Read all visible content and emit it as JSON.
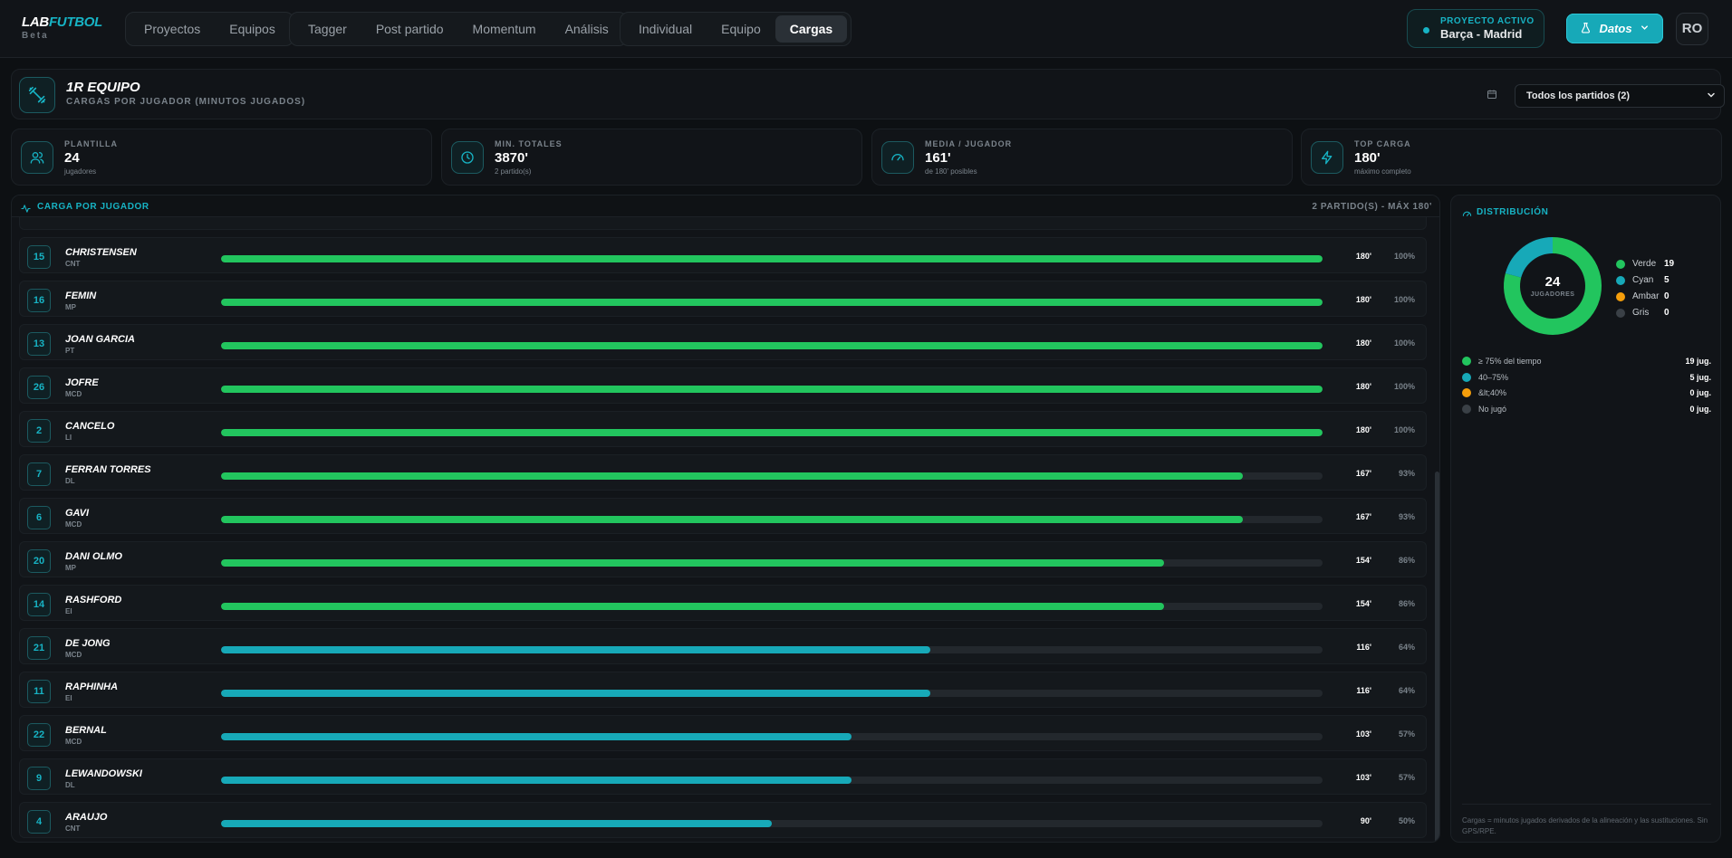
{
  "app": {
    "logo_a": "LAB",
    "logo_b": "FUTBOL",
    "logo_sub": "Beta"
  },
  "nav": {
    "group1": [
      "Proyectos",
      "Equipos"
    ],
    "group2": [
      "Tagger",
      "Post partido",
      "Momentum",
      "Análisis"
    ],
    "group3": [
      "Individual",
      "Equipo",
      "Cargas"
    ],
    "active": "Cargas"
  },
  "project": {
    "label": "PROYECTO ACTIVO",
    "name": "Barça - Madrid"
  },
  "datos_button": "Datos",
  "user_initials": "RO",
  "header": {
    "title": "1R EQUIPO",
    "subtitle": "CARGAS POR JUGADOR (MINUTOS JUGADOS)",
    "filter_value": "Todos los partidos (2)"
  },
  "stats": [
    {
      "label": "PLANTILLA",
      "value": "24",
      "sub": "jugadores",
      "icon": "users-icon"
    },
    {
      "label": "MIN. TOTALES",
      "value": "3870'",
      "sub": "2 partido(s)",
      "icon": "clock-icon"
    },
    {
      "label": "MEDIA / JUGADOR",
      "value": "161'",
      "sub": "de 180' posibles",
      "icon": "gauge-icon"
    },
    {
      "label": "TOP CARGA",
      "value": "180'",
      "sub": "máximo completo",
      "icon": "bolt-icon"
    }
  ],
  "main": {
    "title": "CARGA POR JUGADOR",
    "right": "2 PARTIDO(S) - MÁX 180'"
  },
  "players": [
    {
      "num": "15",
      "name": "CHRISTENSEN",
      "pos": "CNT",
      "mins": "180'",
      "pct": "100%",
      "frac": 1.0,
      "color": "#22c55e"
    },
    {
      "num": "16",
      "name": "FEMIN",
      "pos": "MP",
      "mins": "180'",
      "pct": "100%",
      "frac": 1.0,
      "color": "#22c55e"
    },
    {
      "num": "13",
      "name": "JOAN GARCIA",
      "pos": "PT",
      "mins": "180'",
      "pct": "100%",
      "frac": 1.0,
      "color": "#22c55e"
    },
    {
      "num": "26",
      "name": "JOFRE",
      "pos": "MCD",
      "mins": "180'",
      "pct": "100%",
      "frac": 1.0,
      "color": "#22c55e"
    },
    {
      "num": "2",
      "name": "CANCELO",
      "pos": "LI",
      "mins": "180'",
      "pct": "100%",
      "frac": 1.0,
      "color": "#22c55e"
    },
    {
      "num": "7",
      "name": "FERRAN TORRES",
      "pos": "DL",
      "mins": "167'",
      "pct": "93%",
      "frac": 0.928,
      "color": "#22c55e"
    },
    {
      "num": "6",
      "name": "GAVI",
      "pos": "MCD",
      "mins": "167'",
      "pct": "93%",
      "frac": 0.928,
      "color": "#22c55e"
    },
    {
      "num": "20",
      "name": "DANI OLMO",
      "pos": "MP",
      "mins": "154'",
      "pct": "86%",
      "frac": 0.856,
      "color": "#22c55e"
    },
    {
      "num": "14",
      "name": "RASHFORD",
      "pos": "EI",
      "mins": "154'",
      "pct": "86%",
      "frac": 0.856,
      "color": "#22c55e"
    },
    {
      "num": "21",
      "name": "DE JONG",
      "pos": "MCD",
      "mins": "116'",
      "pct": "64%",
      "frac": 0.644,
      "color": "#17a9b8"
    },
    {
      "num": "11",
      "name": "RAPHINHA",
      "pos": "EI",
      "mins": "116'",
      "pct": "64%",
      "frac": 0.644,
      "color": "#17a9b8"
    },
    {
      "num": "22",
      "name": "BERNAL",
      "pos": "MCD",
      "mins": "103'",
      "pct": "57%",
      "frac": 0.572,
      "color": "#17a9b8"
    },
    {
      "num": "9",
      "name": "LEWANDOWSKI",
      "pos": "DL",
      "mins": "103'",
      "pct": "57%",
      "frac": 0.572,
      "color": "#17a9b8"
    },
    {
      "num": "4",
      "name": "ARAUJO",
      "pos": "CNT",
      "mins": "90'",
      "pct": "50%",
      "frac": 0.5,
      "color": "#17a9b8"
    }
  ],
  "distribution": {
    "title": "DISTRIBUCIÓN",
    "total": "24",
    "total_label": "JUGADORES",
    "legend": [
      {
        "name": "Verde",
        "count": "19",
        "value": 19,
        "color": "#22c55e"
      },
      {
        "name": "Cyan",
        "count": "5",
        "value": 5,
        "color": "#17a9b8"
      },
      {
        "name": "Ambar",
        "count": "0",
        "value": 0,
        "color": "#f59e0b"
      },
      {
        "name": "Gris",
        "count": "0",
        "value": 0,
        "color": "#3a4046"
      }
    ],
    "breakdown": [
      {
        "label": "≥ 75% del tiempo",
        "count": "19 jug.",
        "color": "#22c55e"
      },
      {
        "label": "40–75%",
        "count": "5 jug.",
        "color": "#17a9b8"
      },
      {
        "label": "&lt;40%",
        "count": "0 jug.",
        "color": "#f59e0b"
      },
      {
        "label": "No jugó",
        "count": "0 jug.",
        "color": "#3a4046"
      }
    ],
    "footnote": "Cargas = minutos jugados derivados de la alineación y las sustituciones. Sin GPS/RPE."
  }
}
